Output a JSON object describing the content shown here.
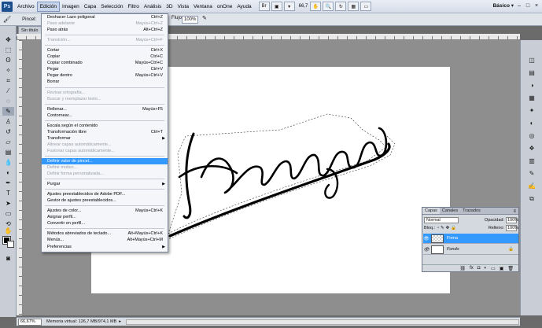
{
  "menubar": {
    "logo": "Ps",
    "items": [
      "Archivo",
      "Edición",
      "Imagen",
      "Capa",
      "Selección",
      "Filtro",
      "Análisis",
      "3D",
      "Vista",
      "Ventana",
      "onOne",
      "Ayuda"
    ],
    "zoom": "66,7",
    "workspace": "Básico",
    "window_controls": [
      "–",
      "□",
      "×"
    ]
  },
  "options": {
    "brush_label": "Pincel:",
    "flow_label": "Flujo:",
    "flow_value": "100%"
  },
  "document": {
    "tab_title": "Sin título"
  },
  "menu": {
    "items": [
      {
        "label": "Deshacer Lazo poligonal",
        "shortcut": "Ctrl+Z",
        "disabled": false
      },
      {
        "label": "Paso adelante",
        "shortcut": "Mayús+Ctrl+Z",
        "disabled": true
      },
      {
        "label": "Paso atrás",
        "shortcut": "Alt+Ctrl+Z",
        "disabled": false
      },
      {
        "sep": true
      },
      {
        "label": "Transición...",
        "shortcut": "Mayús+Ctrl+F",
        "disabled": true
      },
      {
        "sep": true
      },
      {
        "label": "Cortar",
        "shortcut": "Ctrl+X",
        "disabled": false
      },
      {
        "label": "Copiar",
        "shortcut": "Ctrl+C",
        "disabled": false
      },
      {
        "label": "Copiar combinado",
        "shortcut": "Mayús+Ctrl+C",
        "disabled": false
      },
      {
        "label": "Pegar",
        "shortcut": "Ctrl+V",
        "disabled": false
      },
      {
        "label": "Pegar dentro",
        "shortcut": "Mayús+Ctrl+V",
        "disabled": false
      },
      {
        "label": "Borrar",
        "shortcut": "",
        "disabled": false
      },
      {
        "sep": true
      },
      {
        "label": "Revisar ortografía...",
        "shortcut": "",
        "disabled": true
      },
      {
        "label": "Buscar y reemplazar texto...",
        "shortcut": "",
        "disabled": true
      },
      {
        "sep": true
      },
      {
        "label": "Rellenar...",
        "shortcut": "Mayús+F5",
        "disabled": false
      },
      {
        "label": "Contornear...",
        "shortcut": "",
        "disabled": false
      },
      {
        "sep": true
      },
      {
        "label": "Escala según el contenido",
        "shortcut": "",
        "disabled": false
      },
      {
        "label": "Transformación libre",
        "shortcut": "Ctrl+T",
        "disabled": false
      },
      {
        "label": "Transformar",
        "shortcut": "",
        "disabled": false,
        "submenu": true
      },
      {
        "label": "Alinear capas automáticamente...",
        "shortcut": "",
        "disabled": true
      },
      {
        "label": "Fusionar capas automáticamente...",
        "shortcut": "",
        "disabled": true
      },
      {
        "sep": true
      },
      {
        "label": "Definir valor de pincel...",
        "shortcut": "",
        "disabled": false,
        "highlighted": true
      },
      {
        "label": "Definir motivo...",
        "shortcut": "",
        "disabled": true
      },
      {
        "label": "Definir forma personalizada...",
        "shortcut": "",
        "disabled": true
      },
      {
        "sep": true
      },
      {
        "label": "Purgar",
        "shortcut": "",
        "disabled": false,
        "submenu": true
      },
      {
        "sep": true
      },
      {
        "label": "Ajustes preestablecidos de Adobe PDF...",
        "shortcut": "",
        "disabled": false
      },
      {
        "label": "Gestor de ajustes preestablecidos...",
        "shortcut": "",
        "disabled": false
      },
      {
        "sep": true
      },
      {
        "label": "Ajustes de color...",
        "shortcut": "Mayús+Ctrl+K",
        "disabled": false
      },
      {
        "label": "Asignar perfil...",
        "shortcut": "",
        "disabled": false
      },
      {
        "label": "Convertir en perfil...",
        "shortcut": "",
        "disabled": false
      },
      {
        "sep": true
      },
      {
        "label": "Métodos abreviados de teclado...",
        "shortcut": "Alt+Mayús+Ctrl+K",
        "disabled": false
      },
      {
        "label": "Menús...",
        "shortcut": "Alt+Mayús+Ctrl+M",
        "disabled": false
      },
      {
        "label": "Preferencias",
        "shortcut": "",
        "disabled": false,
        "submenu": true
      }
    ]
  },
  "layers_panel": {
    "tabs": [
      "Capas",
      "Canales",
      "Trazados"
    ],
    "blend_mode": "Normal",
    "opacity_label": "Opacidad:",
    "opacity_value": "100%",
    "lock_label": "Bloq.:",
    "fill_label": "Relleno:",
    "fill_value": "100%",
    "layers": [
      {
        "name": "Firma",
        "selected": true
      },
      {
        "name": "Fondo",
        "selected": false
      }
    ]
  },
  "status": {
    "zoom": "66,67%",
    "info": "Memoria virtual: 126,7 MB/974,1 MB"
  }
}
